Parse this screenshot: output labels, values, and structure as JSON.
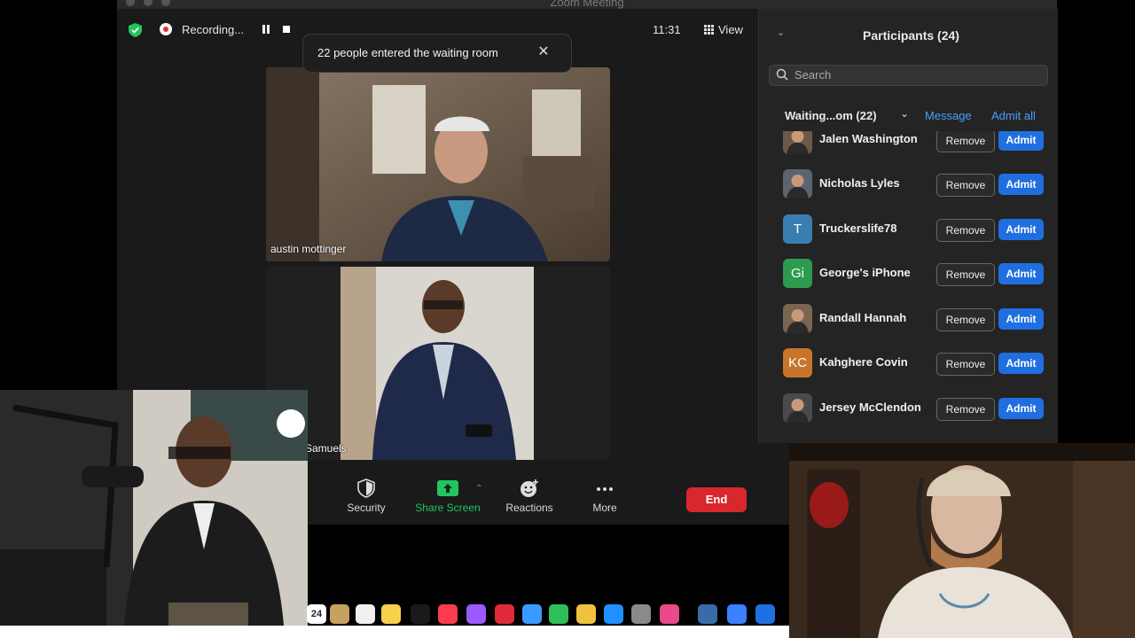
{
  "window": {
    "title": "Zoom Meeting"
  },
  "topbar": {
    "recording_label": "Recording...",
    "clock": "11:31",
    "view_label": "View"
  },
  "notification": {
    "text": "22 people entered the waiting room"
  },
  "tiles": [
    {
      "name": "austin mottinger"
    },
    {
      "name": "Samuels"
    }
  ],
  "toolbar": {
    "security": "Security",
    "share": "Share Screen",
    "reactions": "Reactions",
    "more": "More",
    "end": "End"
  },
  "panel": {
    "title": "Participants (24)",
    "search_placeholder": "Search",
    "waiting_label": "Waiting...om (22)",
    "message": "Message",
    "admit_all": "Admit all",
    "remove_label": "Remove",
    "admit_label": "Admit",
    "participants": [
      {
        "name": "Jalen Washington",
        "avatar": "photo",
        "color": "#6b5a4a"
      },
      {
        "name": "Nicholas Lyles",
        "avatar": "photo",
        "color": "#5c6470"
      },
      {
        "name": "Truckerslife78",
        "avatar": "T",
        "color": "#3a7db0"
      },
      {
        "name": "George's iPhone",
        "avatar": "Gi",
        "color": "#2e9a4e"
      },
      {
        "name": "Randall Hannah",
        "avatar": "photo",
        "color": "#7a6650"
      },
      {
        "name": "Kahghere Covin",
        "avatar": "KC",
        "color": "#c8742a"
      },
      {
        "name": "Jersey McClendon",
        "avatar": "photo",
        "color": "#4a4a4a"
      }
    ]
  },
  "dock": {
    "calendar_day": "24"
  },
  "colors": {
    "accent": "#1f6fe0",
    "end": "#d9272e",
    "share": "#22c55e",
    "link": "#4a9eff"
  }
}
